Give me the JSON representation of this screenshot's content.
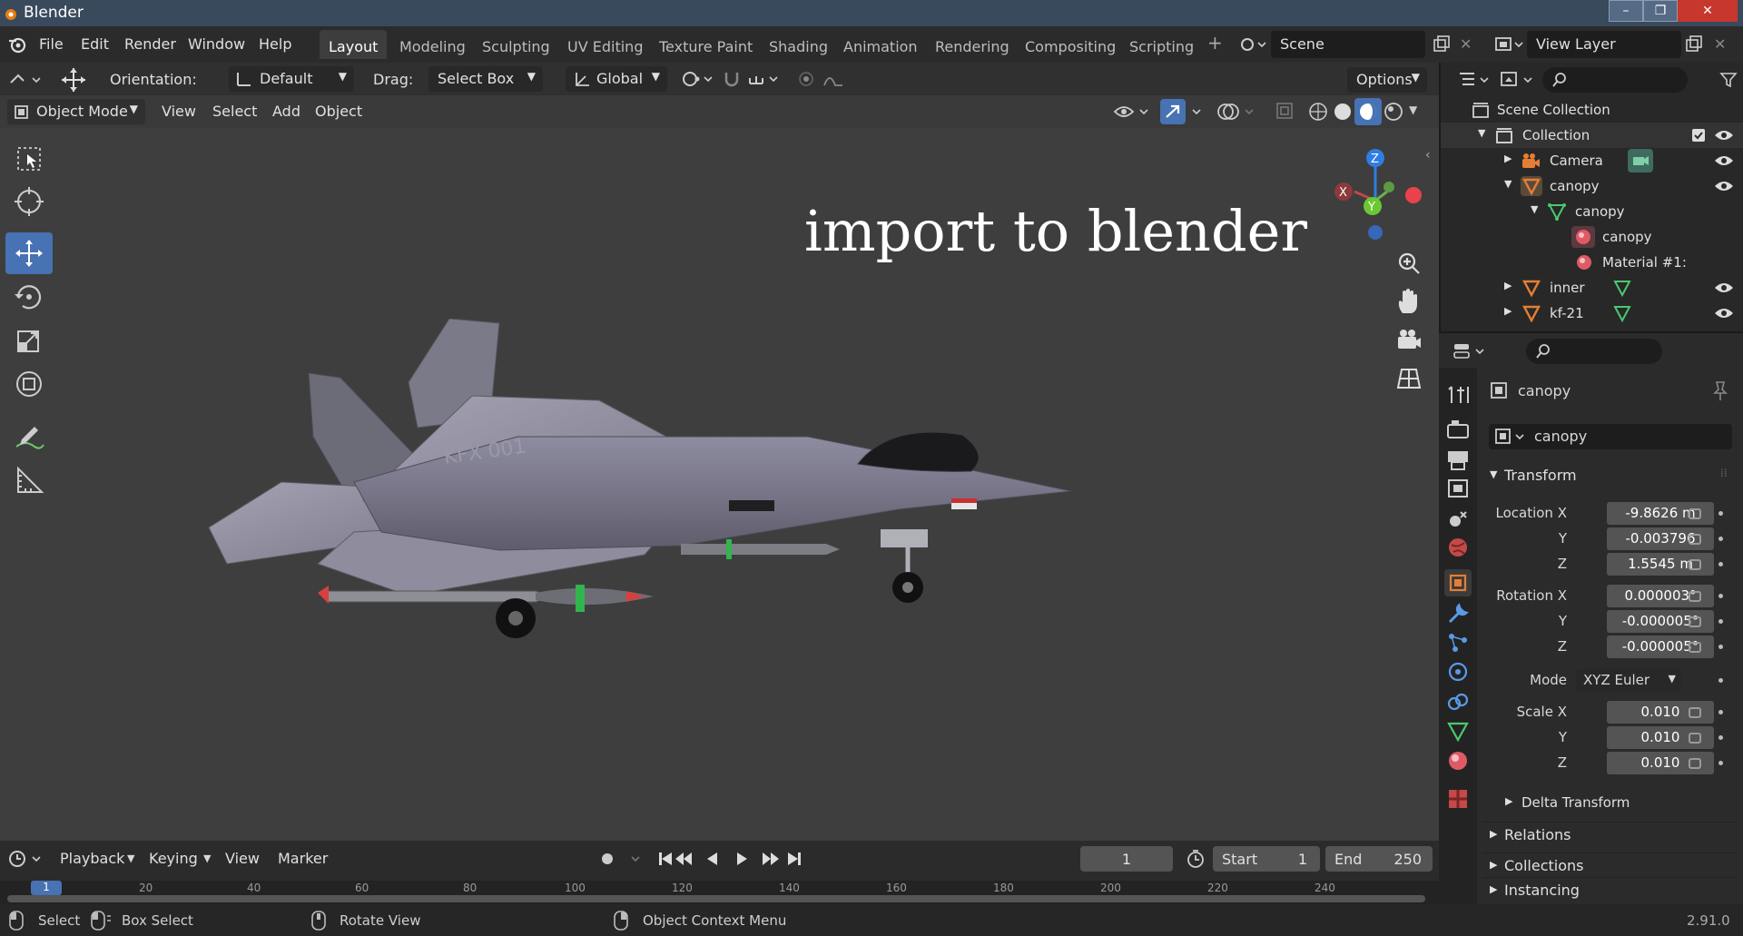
{
  "window": {
    "title": "Blender",
    "version": "2.91.0"
  },
  "menu": {
    "items": [
      "File",
      "Edit",
      "Render",
      "Window",
      "Help"
    ],
    "workspaces": [
      "Layout",
      "Modeling",
      "Sculpting",
      "UV Editing",
      "Texture Paint",
      "Shading",
      "Animation",
      "Rendering",
      "Compositing",
      "Scripting"
    ],
    "active_workspace": "Layout",
    "scene": "Scene",
    "view_layer": "View Layer"
  },
  "tool_header": {
    "orientation_label": "Orientation:",
    "orientation_value": "Default",
    "drag_label": "Drag:",
    "drag_value": "Select Box",
    "transform_orientation": "Global",
    "options": "Options"
  },
  "viewport_header": {
    "mode": "Object Mode",
    "menus": [
      "View",
      "Select",
      "Add",
      "Object"
    ]
  },
  "viewport": {
    "overlay_text": "import to blender",
    "gizmo": {
      "z": "Z",
      "y": "Y",
      "x": "X"
    },
    "decal_text": "KFX 001"
  },
  "outliner": {
    "rows": [
      {
        "label": "Scene Collection",
        "icon": "scene-collection-icon"
      },
      {
        "label": "Collection",
        "icon": "collection-icon"
      },
      {
        "label": "Camera",
        "icon": "camera-icon"
      },
      {
        "label": "canopy",
        "icon": "mesh-object-icon"
      },
      {
        "label": "canopy",
        "icon": "mesh-data-icon"
      },
      {
        "label": "canopy",
        "icon": "material-icon"
      },
      {
        "label": "Material #1:",
        "icon": "material-icon"
      },
      {
        "label": "inner",
        "icon": "mesh-object-icon"
      },
      {
        "label": "kf-21",
        "icon": "mesh-object-icon"
      }
    ]
  },
  "properties": {
    "object_name": "canopy",
    "object_data_name": "canopy",
    "transform_title": "Transform",
    "location_label": "Location X",
    "location": [
      "-9.8626 m",
      "-0.003796",
      "1.5545 m"
    ],
    "rotation_label": "Rotation X",
    "rotation": [
      "0.000003°",
      "-0.000005°",
      "-0.000005°"
    ],
    "axis_y": "Y",
    "axis_z": "Z",
    "mode_label": "Mode",
    "mode_value": "XYZ Euler",
    "scale_label": "Scale X",
    "scale": [
      "0.010",
      "0.010",
      "0.010"
    ],
    "sections": [
      "Delta Transform",
      "Relations",
      "Collections",
      "Instancing"
    ]
  },
  "timeline": {
    "menus": [
      "Playback",
      "Keying",
      "View",
      "Marker"
    ],
    "current_frame": "1",
    "start_label": "Start",
    "start": "1",
    "end_label": "End",
    "end": "250",
    "ruler_ticks": [
      "1",
      "20",
      "40",
      "60",
      "80",
      "100",
      "120",
      "140",
      "160",
      "180",
      "200",
      "220",
      "240"
    ]
  },
  "statusbar": {
    "items": [
      "Select",
      "Box Select",
      "Rotate View",
      "Object Context Menu"
    ]
  },
  "colors": {
    "accent": "#4772b3",
    "object_orange": "#e57e35",
    "mesh_green": "#49c96e"
  }
}
